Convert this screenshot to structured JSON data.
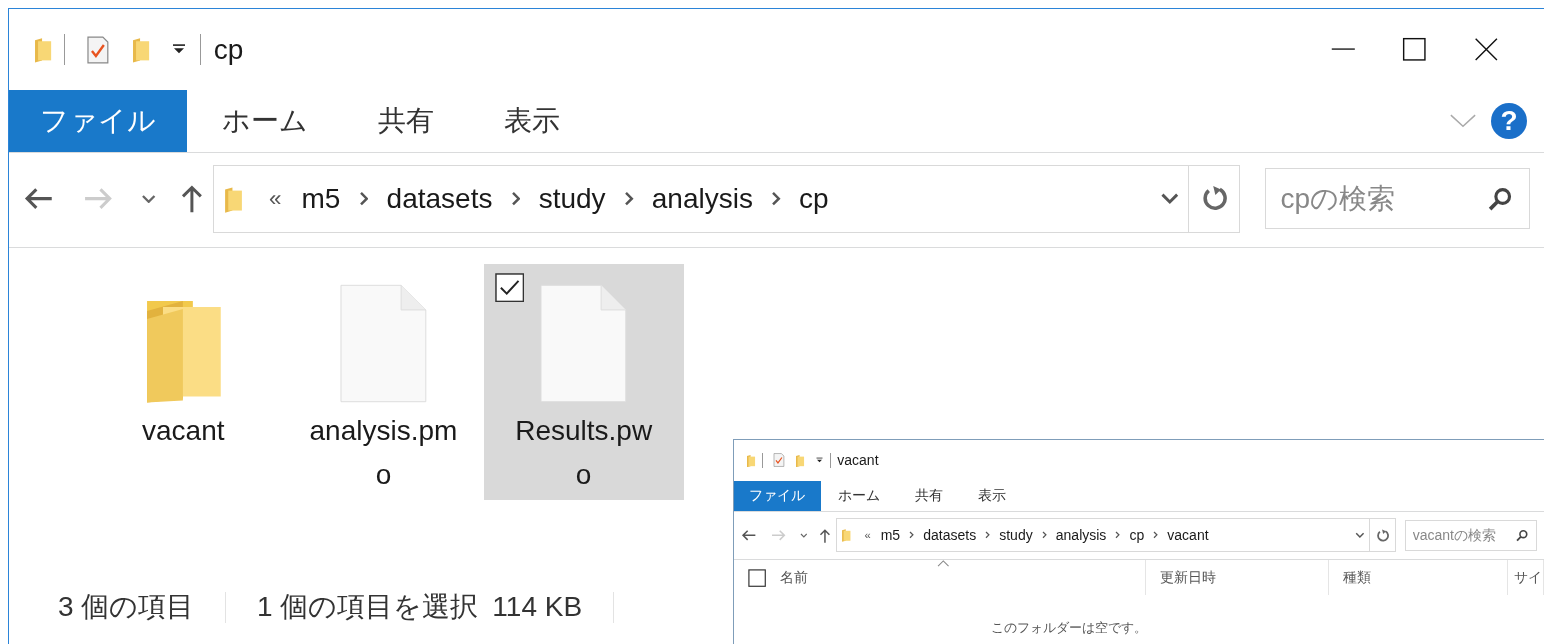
{
  "windows": [
    {
      "title": "cp",
      "ribbon_tabs": [
        {
          "label": "ファイル",
          "selected": true
        },
        {
          "label": "ホーム",
          "selected": false
        },
        {
          "label": "共有",
          "selected": false
        },
        {
          "label": "表示",
          "selected": false
        }
      ],
      "help": "?",
      "forward_disabled": true,
      "overflow_marker": "«",
      "breadcrumb": [
        "m5",
        "datasets",
        "study",
        "analysis",
        "cp"
      ],
      "search": {
        "placeholder": "cpの検索"
      },
      "items": [
        {
          "name": "vacant",
          "kind": "folder",
          "selected": false
        },
        {
          "name": "analysis.pmo",
          "kind": "file",
          "selected": false
        },
        {
          "name": "Results.pwo",
          "kind": "file",
          "selected": true
        }
      ],
      "status_bar": {
        "count": "3 個の項目",
        "selection": "1 個の項目を選択",
        "size": "114 KB"
      }
    },
    {
      "title": "vacant",
      "ribbon_tabs": [
        {
          "label": "ファイル",
          "selected": true
        },
        {
          "label": "ホーム",
          "selected": false
        },
        {
          "label": "共有",
          "selected": false
        },
        {
          "label": "表示",
          "selected": false
        }
      ],
      "forward_disabled": true,
      "overflow_marker": "«",
      "breadcrumb": [
        "m5",
        "datasets",
        "study",
        "analysis",
        "cp",
        "vacant"
      ],
      "search": {
        "placeholder": "vacantの検索"
      },
      "select_all_checked": false,
      "columns": [
        {
          "label": "名前",
          "sorted": true
        },
        {
          "label": "更新日時",
          "sorted": false
        },
        {
          "label": "種類",
          "sorted": false
        },
        {
          "label": "サイ",
          "sorted": false
        }
      ],
      "empty_message": "このフォルダーは空です。"
    }
  ]
}
